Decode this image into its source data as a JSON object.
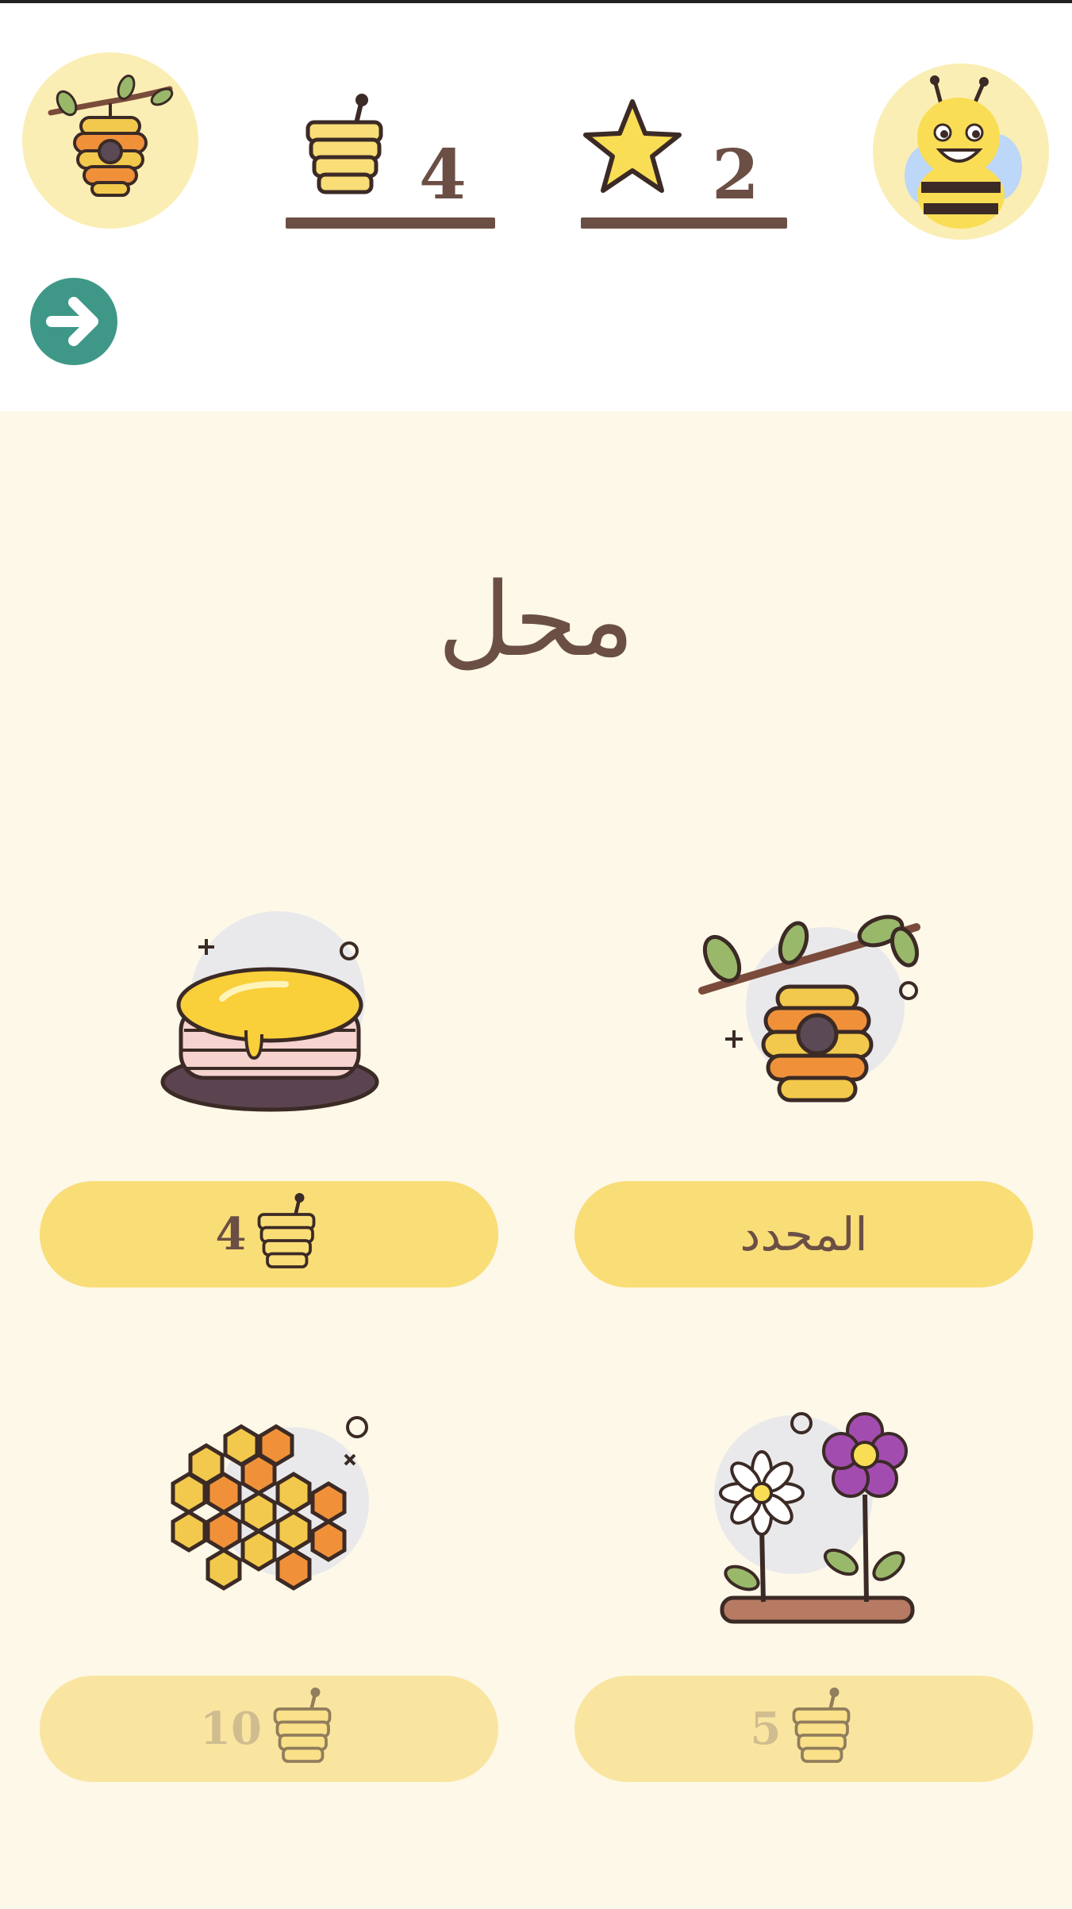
{
  "header": {
    "honey_count": "4",
    "star_count": "2"
  },
  "shop": {
    "title": "محل",
    "items": [
      {
        "name": "pancakes",
        "price": "4",
        "state": "buy"
      },
      {
        "name": "hive",
        "label": "المحدد",
        "state": "selected"
      },
      {
        "name": "honeycomb",
        "price": "10",
        "state": "locked"
      },
      {
        "name": "flowers",
        "price": "5",
        "state": "locked"
      }
    ]
  },
  "colors": {
    "accent_yellow": "#f9dd77",
    "text_brown": "#6b4f45",
    "back_button_teal": "#3f9887",
    "shop_background": "#fdf8e8"
  }
}
